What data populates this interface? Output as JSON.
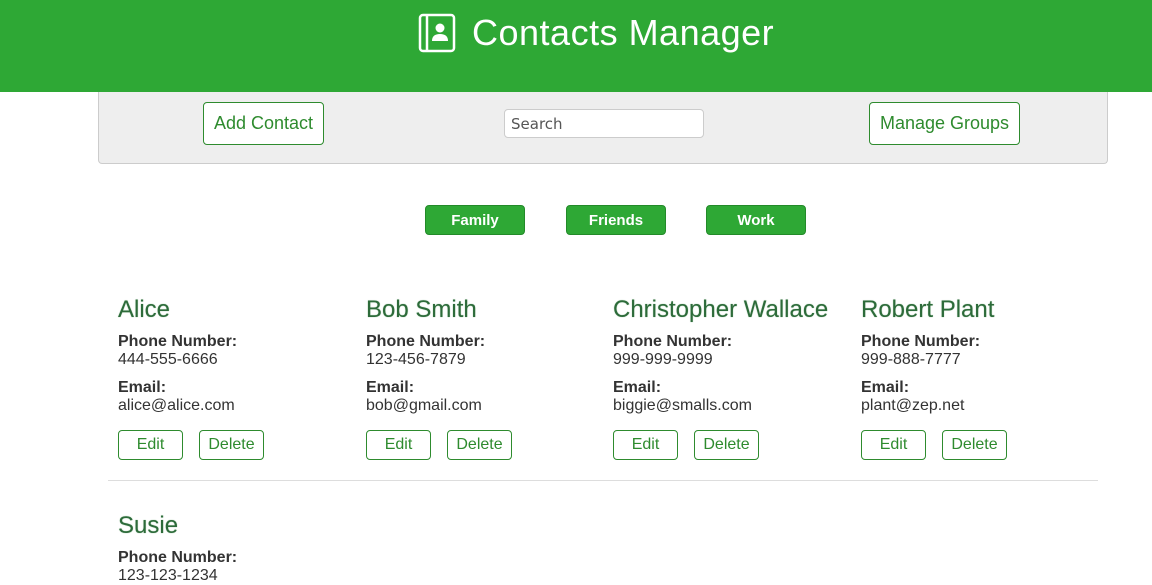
{
  "header": {
    "title": "Contacts Manager",
    "icon": "address-book-icon",
    "background": "#2ea835"
  },
  "toolbar": {
    "add_label": "Add Contact",
    "search_placeholder": "Search",
    "search_value": "",
    "groups_label": "Manage Groups"
  },
  "filters": [
    {
      "label": "Family"
    },
    {
      "label": "Friends"
    },
    {
      "label": "Work"
    }
  ],
  "labels": {
    "phone": "Phone Number:",
    "email": "Email:",
    "edit": "Edit",
    "delete": "Delete"
  },
  "contacts": [
    {
      "name": "Alice",
      "phone": "444-555-6666",
      "email": "alice@alice.com"
    },
    {
      "name": "Bob Smith",
      "phone": "123-456-7879",
      "email": "bob@gmail.com"
    },
    {
      "name": "Christopher Wallace",
      "phone": "999-999-9999",
      "email": "biggie@smalls.com"
    },
    {
      "name": "Robert Plant",
      "phone": "999-888-7777",
      "email": "plant@zep.net"
    },
    {
      "name": "Susie",
      "phone": "123-123-1234",
      "email": ""
    }
  ]
}
